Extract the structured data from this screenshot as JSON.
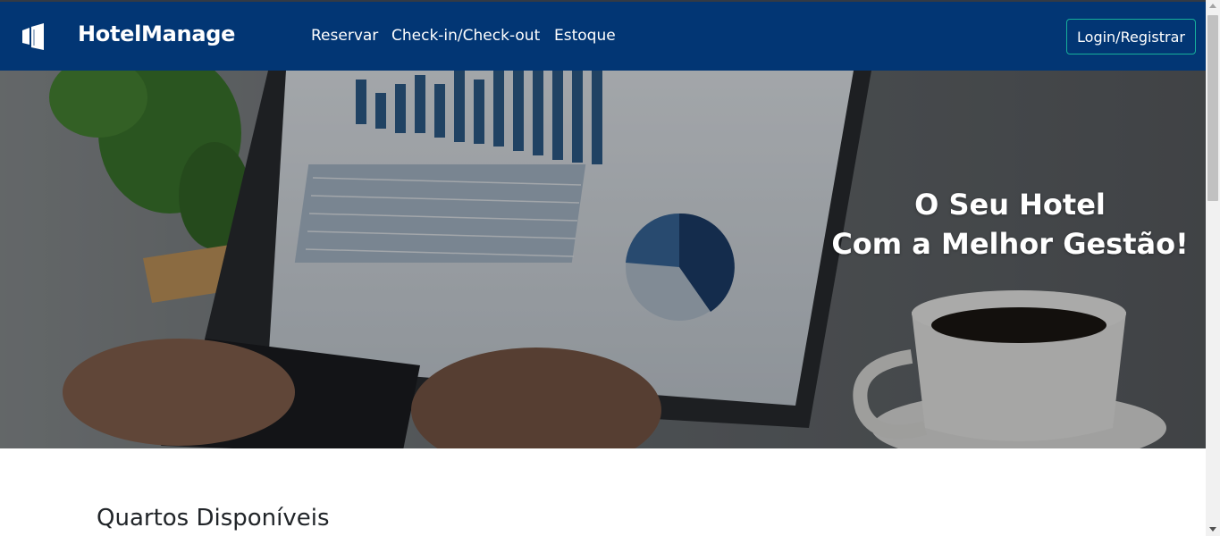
{
  "navbar": {
    "brand": "HotelManage",
    "logo_icon": "building-icon",
    "links": [
      "Reservar",
      "Check-in/Check-out",
      "Estoque"
    ],
    "login_label": "Login/Registrar",
    "background_color": "#023674",
    "login_border_color": "#16b09b"
  },
  "hero": {
    "title_line1": "O Seu Hotel",
    "title_line2": "Com a Melhor Gestão!",
    "image": "laptop-dashboard-coffee-photo"
  },
  "section": {
    "title": "Quartos Disponíveis"
  }
}
